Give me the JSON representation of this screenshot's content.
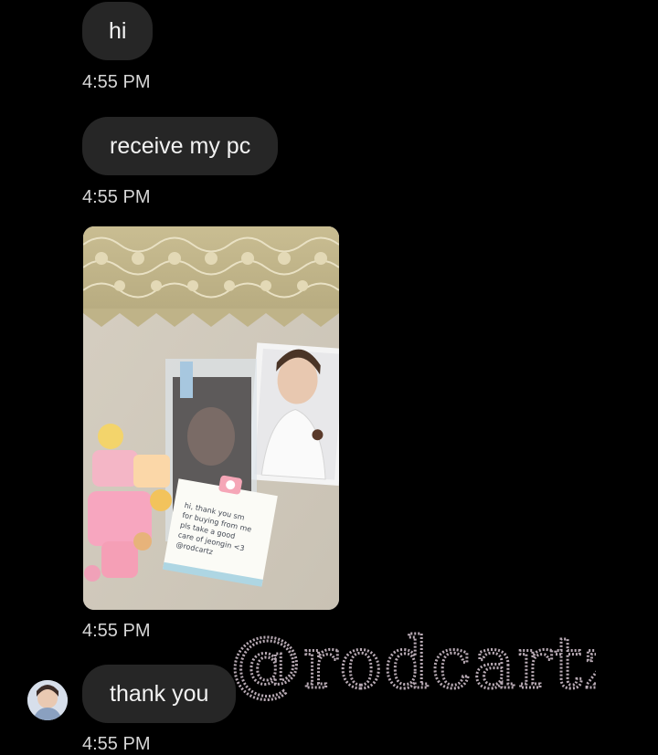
{
  "messages": [
    {
      "text": "hi",
      "time": "4:55 PM"
    },
    {
      "text": "receive my pc",
      "time": "4:55 PM"
    },
    {
      "image": "photocard-photo",
      "time": "4:55 PM"
    },
    {
      "text": "thank you",
      "time": "4:55 PM"
    }
  ],
  "photo_note": {
    "lines": [
      "hi, thank you sm",
      "for buying from me",
      "pls take a good",
      "care of jeongin <3",
      "@rodcartz"
    ]
  },
  "watermark": {
    "text": "@rodcartz"
  },
  "icons": {
    "avatar": "user-avatar-icon",
    "camera": "camera-icon"
  },
  "colors": {
    "background": "#000000",
    "bubble": "#262626",
    "text": "#f2f2f2",
    "time": "#d6d6d6",
    "watermark": "#b8aab4"
  }
}
